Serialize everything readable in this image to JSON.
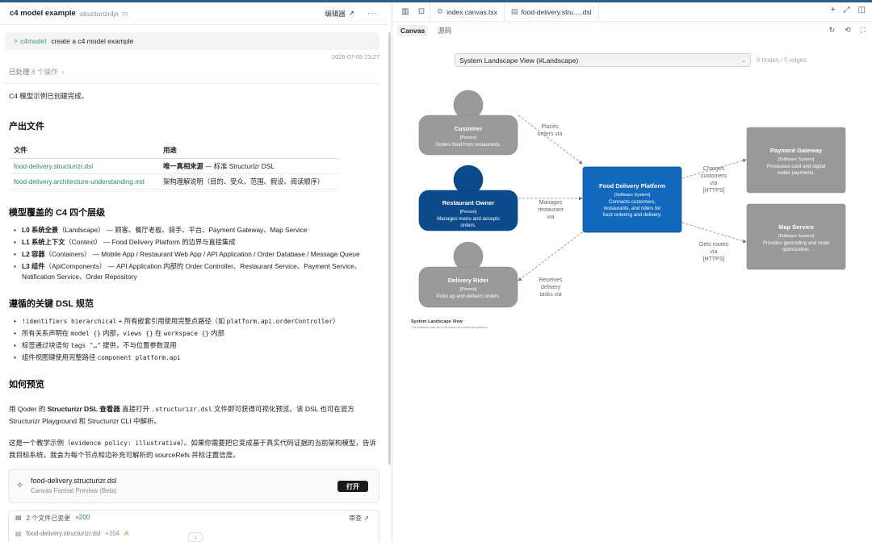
{
  "left": {
    "title": "c4 model example",
    "subtitle": "structurizr4js",
    "editor_label": "编辑器",
    "prompt_tag": "c4model",
    "prompt_text": "create a c4 model example",
    "timestamp": "2026-07-09 23:27",
    "processed_label": "已处理",
    "processed_count": "8 个操作",
    "intro": "C4 模型示例已创建完成。",
    "h_files": "产出文件",
    "table_headers": [
      "文件",
      "用途"
    ],
    "table_rows": [
      {
        "file": "food-delivery.structurizr.dsl",
        "bold": "唯一真相来源",
        "rest": " — 标准 Structurizr DSL"
      },
      {
        "file": "food-delivery.architecture-understanding.md",
        "bold": "",
        "rest": "架构理解说明（目的、受众、范围、假设、阅读顺序）"
      }
    ],
    "h_levels": "模型覆盖的 C4 四个层级",
    "levels": [
      {
        "b": "L0 系统全景",
        "m": "（Landscape）",
        "t": " — 顾客、餐厅老板、骑手、平台、Payment Gateway、Map Service"
      },
      {
        "b": "L1 系统上下文",
        "m": "（Context）",
        "t": " — Food Delivery Platform 的边界与直接集成"
      },
      {
        "b": "L2 容器",
        "m": "（Containers）",
        "t": " — Mobile App / Restaurant Web App / API Application / Order Database / Message Queue"
      },
      {
        "b": "L3 组件",
        "m": "（ApiComponents）",
        "t": " — API Application 内部的 Order Controller、Restaurant Service、Payment Service、Notification Service、Order Repository"
      }
    ],
    "h_rules": "遵循的关键 DSL 规范",
    "rules": [
      {
        "c1": "!identifiers hierarchical",
        "t1": " + 所有嵌套引用使用完整点路径（如 ",
        "c2": "platform.api.orderController",
        "t2": "）"
      },
      {
        "c1": "",
        "t1": "所有关系声明在 ",
        "c2": "model {}",
        "t2": " 内部，",
        "c3": "views {}",
        "t3": " 在 ",
        "c4": "workspace {}",
        "t4": " 内部"
      },
      {
        "c1": "",
        "t1": "标签通过块语句 ",
        "c2": "tags \"…\"",
        "t2": " 提供，不与位置参数混用"
      },
      {
        "c1": "",
        "t1": "组件视图键使用完整路径 ",
        "c2": "component platform.api",
        "t2": ""
      }
    ],
    "h_preview": "如何预览",
    "preview_p1_a": "用 Qoder 的 ",
    "preview_p1_b": "Structurizr DSL 查看器",
    "preview_p1_c": " 直接打开 ",
    "preview_p1_code": ".structurizr.dsl",
    "preview_p1_d": " 文件即可获得可视化预览。该 DSL 也可在官方 Structurizr Playground 和 Structurizr CLI 中解析。",
    "preview_p2_a": "这是一个教学示例（",
    "preview_p2_code": "evidence policy: illustrative",
    "preview_p2_b": "）。如果你需要把它变成基于真实代码证据的当前架构模型，告诉我目标系统，我会为每个节点和边补充可解析的 sourceRefs 并标注置信度。",
    "card_file": "food-delivery.structurizr.dsl",
    "card_sub": "Canvas Format Preview (Beta)",
    "card_open": "打开",
    "changes_label": "2 个文件已变更",
    "changes_plus": "+200",
    "changes_review": "审查",
    "changes_file": "food-delivery.structurizr.dsl",
    "changes_file_plus": "+104",
    "changes_file_status": "A"
  },
  "right": {
    "tab1": "index.canvas.tsx",
    "tab2": "food-delivery.stru.....dsl",
    "subtab_canvas": "Canvas",
    "subtab_source": "源码",
    "view_select": "System Landscape View (#Landscape)",
    "counts": "6 nodes / 5 edges",
    "nodes": {
      "customer": {
        "name": "Customer",
        "kind": "[Person]",
        "desc": "Orders food from restaurants."
      },
      "owner": {
        "name": "Restaurant Owner",
        "kind": "[Person]",
        "desc1": "Manages menu and accepts",
        "desc2": "orders."
      },
      "rider": {
        "name": "Delivery Rider",
        "kind": "[Person]",
        "desc": "Picks up and delivers orders."
      },
      "platform": {
        "name": "Food Delivery Platform",
        "kind": "[Software System]",
        "desc1": "Connects customers,",
        "desc2": "restaurants, and riders for",
        "desc3": "food ordering and delivery."
      },
      "payment": {
        "name": "Payment Gateway",
        "kind": "[Software System]",
        "desc1": "Processes card and digital",
        "desc2": "wallet payments."
      },
      "map": {
        "name": "Map Service",
        "kind": "[Software System]",
        "desc1": "Provides geocoding and route",
        "desc2": "optimization."
      }
    },
    "edges": {
      "e1": [
        "Places",
        "orders via"
      ],
      "e2": [
        "Manages",
        "restaurant",
        "via"
      ],
      "e3": [
        "Receives",
        "delivery",
        "tasks via"
      ],
      "e4": [
        "Charges",
        "customers",
        "via",
        "[HTTPS]"
      ],
      "e5": [
        "Gets routes",
        "via",
        "[HTTPS]"
      ]
    },
    "view_title": "System Landscape View",
    "view_desc": "The platform and all of its users and external systems.",
    "colors": {
      "person_gray": "#9a9a9a",
      "person_blue": "#0b4a8b",
      "platform_blue": "#1168bd",
      "external_gray": "#999999"
    }
  }
}
